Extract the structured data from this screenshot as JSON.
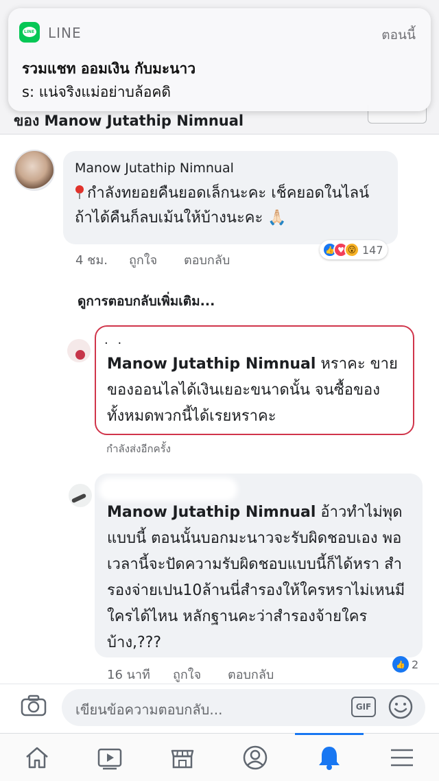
{
  "notification": {
    "app": "LINE",
    "time": "ตอนนี้",
    "title": "รวมแชท ออมเงิน กับมะนาว",
    "body": "s: แน่จริงแม่อย่าบล้อคดิ"
  },
  "header": {
    "title": "ของ Manow Jutathip Nimnual"
  },
  "comment": {
    "author": "Manow Jutathip Nimnual",
    "text": "กำลังทยอยคืนยอดเล็กนะคะ เช็คยอดในไลน์ ถ้าได้คืนก็ลบเม้นให้บ้างนะคะ 🙏🏻",
    "time": "4 ชม.",
    "like_label": "ถูกใจ",
    "reply_label": "ตอบกลับ",
    "reaction_count": "147",
    "reactions": [
      "like",
      "love",
      "wow"
    ]
  },
  "more_replies": "ดูการตอบกลับเพิ่มเติม...",
  "reply1": {
    "dots": "· ·",
    "tag": "Manow Jutathip Nimnual",
    "text": " หราคะ ขายของออนไลได้เงินเยอะขนาดนั้น จนซื้อของทั้งหมดพวกนี้ได้เรยหราคะ",
    "status": "กำลังส่งอีกครั้ง"
  },
  "reply2": {
    "tag": "Manow Jutathip Nimnual",
    "text": " อ้าวทำไม่พุดแบบนี้ ตอนนั้นบอกมะนาวจะรับผิดชอบเอง พอเวลานี้จะปัดความรับผิดชอบแบบนี้ก็ได้หรา สำรองจ่ายเปน10ล้านนี่สำรองให้ใครหราไม่เหนมีใครได้ไหน หลักฐานคะว่าสำรองจ้ายใครบ้าง,???",
    "time": "16 นาที",
    "like_label": "ถูกใจ",
    "reply_label": "ตอบกลับ",
    "reaction_count": "2"
  },
  "composer": {
    "placeholder": "เขียนข้อความตอบกลับ...",
    "gif_label": "GIF"
  },
  "nav": {
    "items": [
      "home-icon",
      "watch-icon",
      "marketplace-icon",
      "profile-icon",
      "notifications-icon",
      "menu-icon"
    ],
    "active": "notifications-icon"
  },
  "colors": {
    "accent": "#1877f2",
    "line_green": "#06c755",
    "error_border": "#d0344a"
  }
}
